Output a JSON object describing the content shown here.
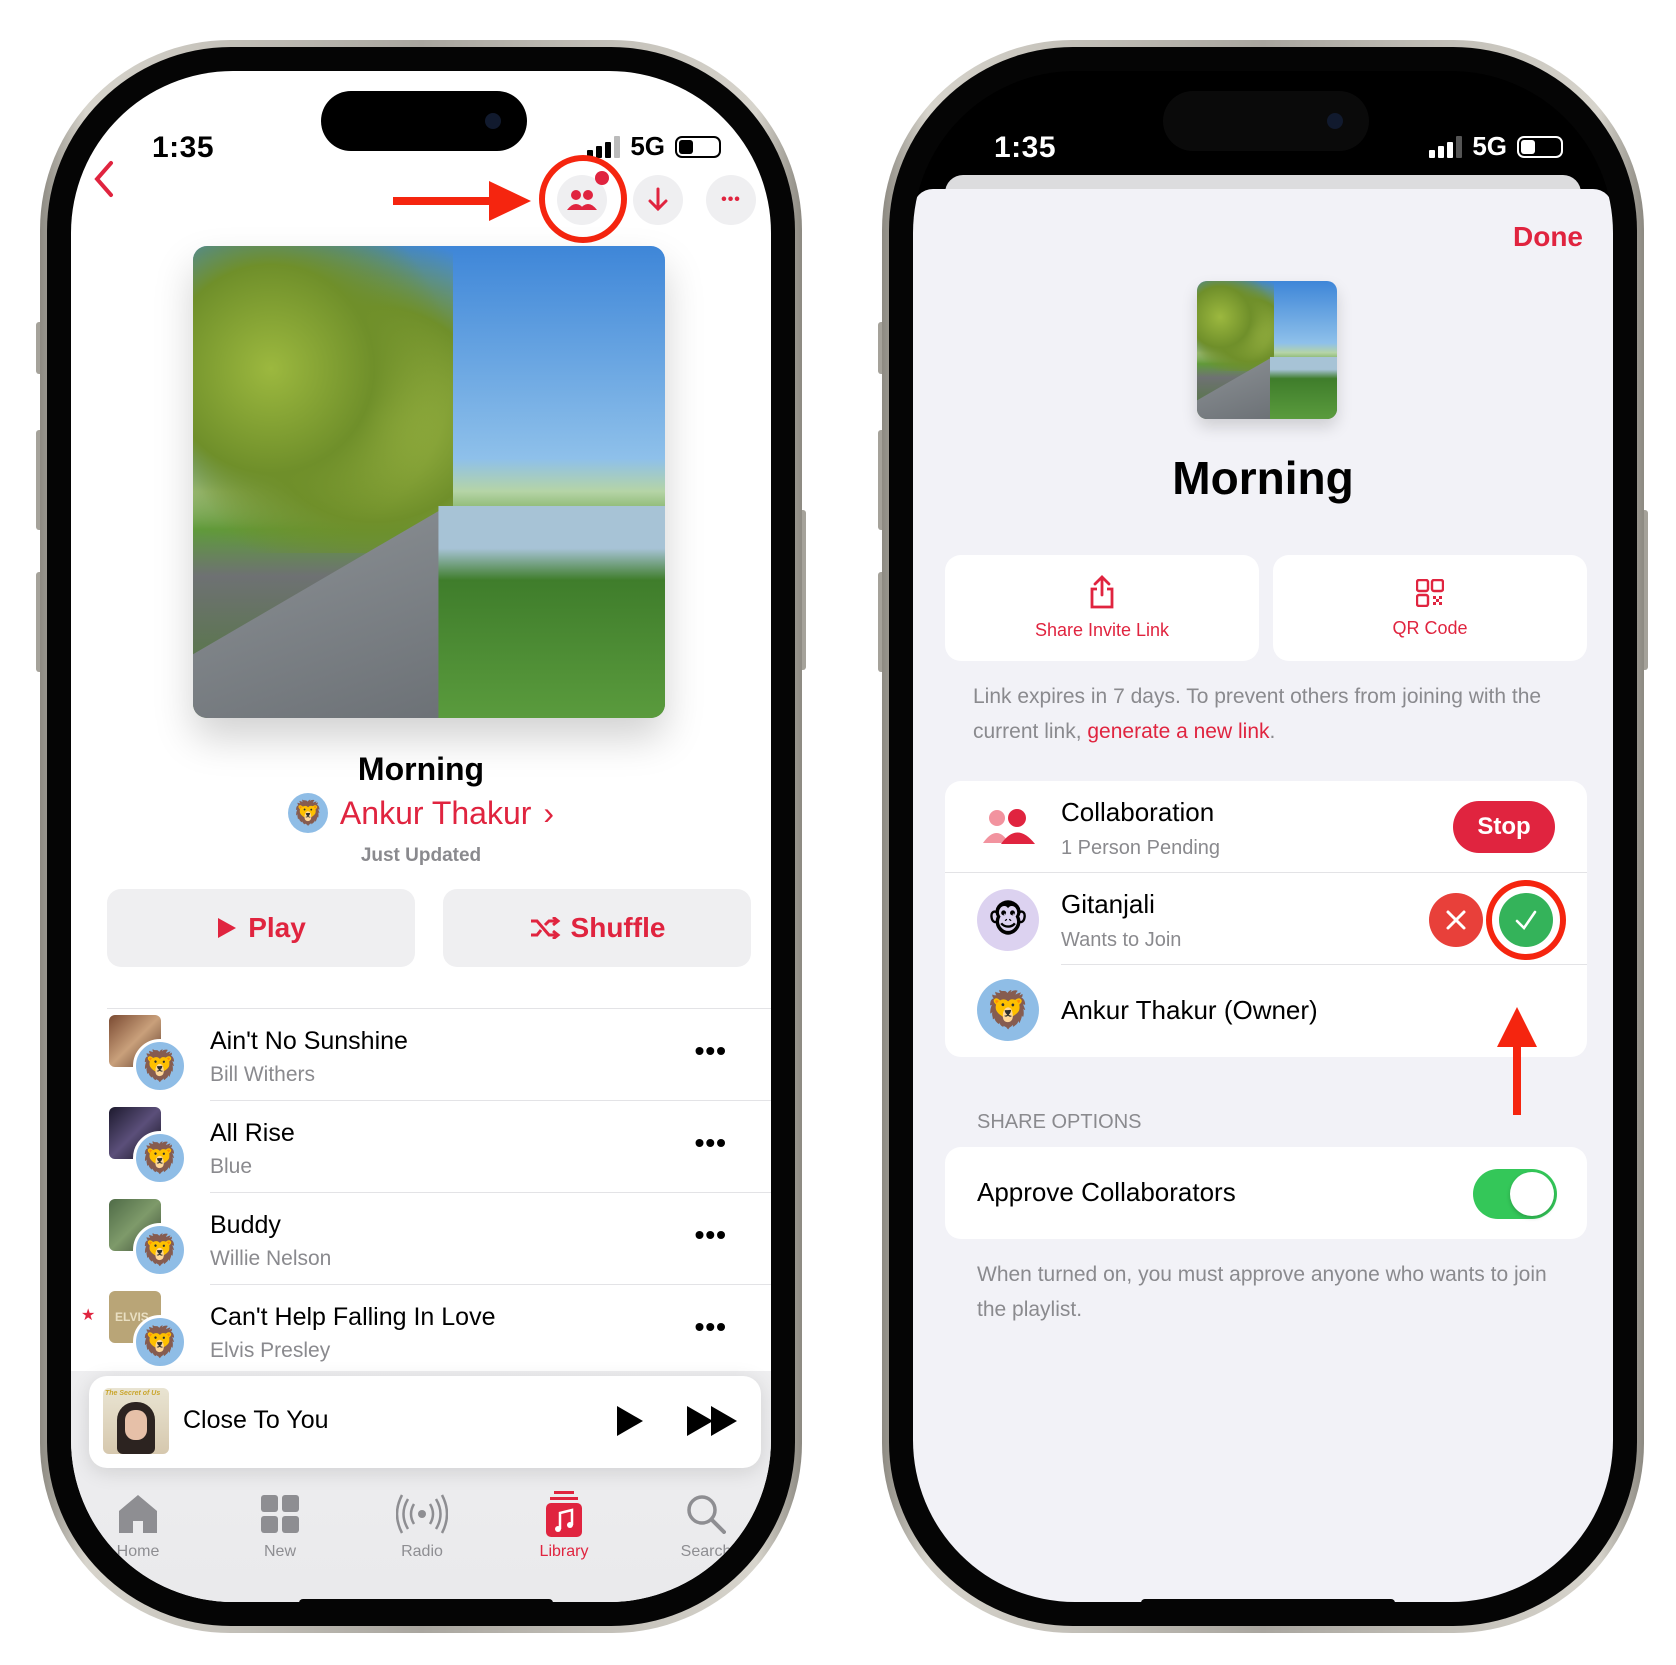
{
  "left_phone": {
    "status": {
      "time": "1:35",
      "network": "5G"
    },
    "nav": {
      "back_icon": "chevron-left-icon",
      "collab_icon": "people-icon",
      "download_icon": "arrow-down-icon",
      "more_icon": "ellipsis-icon",
      "more_label": "•••"
    },
    "playlist": {
      "title": "Morning",
      "owner": "Ankur Thakur",
      "owner_chevron": "›",
      "updated": "Just Updated",
      "owner_avatar": "🦁"
    },
    "actions": {
      "play": "Play",
      "shuffle": "Shuffle"
    },
    "songs": [
      {
        "title": "Ain't No Sunshine",
        "artist": "Bill Withers",
        "favorite": false
      },
      {
        "title": "All Rise",
        "artist": "Blue",
        "favorite": false
      },
      {
        "title": "Buddy",
        "artist": "Willie Nelson",
        "favorite": false
      },
      {
        "title": "Can't Help Falling In Love",
        "artist": "Elvis Presley",
        "favorite": true,
        "art_text": "ELVIS"
      }
    ],
    "song_more": "•••",
    "favorite_star": "★",
    "mini_player": {
      "title": "Close To You",
      "art_text": "The Secret of Us"
    },
    "tabs": [
      {
        "label": "Home",
        "icon": "home-icon",
        "active": false
      },
      {
        "label": "New",
        "icon": "grid-icon",
        "active": false
      },
      {
        "label": "Radio",
        "icon": "radio-icon",
        "active": false
      },
      {
        "label": "Library",
        "icon": "library-icon",
        "active": true
      },
      {
        "label": "Search",
        "icon": "search-icon",
        "active": false
      }
    ]
  },
  "right_phone": {
    "status": {
      "time": "1:35",
      "network": "5G"
    },
    "done": "Done",
    "title": "Morning",
    "share_invite": "Share Invite Link",
    "qr_code": "QR Code",
    "link_note_prefix": "Link expires in 7 days. To prevent others from joining with the current link, ",
    "link_note_link": "generate a new link",
    "link_note_suffix": ".",
    "collaboration": {
      "title": "Collaboration",
      "subtitle": "1 Person Pending",
      "stop": "Stop"
    },
    "pending": {
      "name": "Gitanjali",
      "status": "Wants to Join",
      "avatar": "🐵"
    },
    "owner": {
      "name": "Ankur Thakur (Owner)",
      "avatar": "🦁"
    },
    "share_options_header": "SHARE OPTIONS",
    "approve": {
      "label": "Approve Collaborators",
      "enabled": true
    },
    "approve_note": "When turned on, you must approve anyone who wants to join the playlist."
  },
  "colors": {
    "accent": "#e0243f",
    "green": "#34c759",
    "annotation": "#f5250f"
  }
}
